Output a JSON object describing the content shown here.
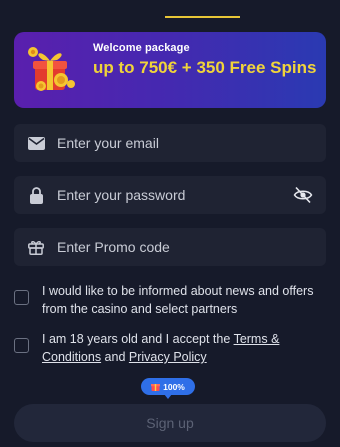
{
  "banner": {
    "small_text": "Welcome package",
    "headline": "up to 750€ + 350 Free Spins"
  },
  "form": {
    "email_placeholder": "Enter your email",
    "password_placeholder": "Enter your password",
    "promo_placeholder": "Enter Promo code"
  },
  "consents": {
    "news_text": "I would like to be informed about news and offers from the casino and select partners",
    "age_prefix": "I am 18 years old and I accept the ",
    "terms_link": "Terms & Conditions",
    "and_text": " and ",
    "privacy_link": "Privacy Policy"
  },
  "badge": {
    "text": "100%"
  },
  "signup": {
    "label": "Sign up"
  },
  "colors": {
    "background": "#161a2a",
    "accent_yellow": "#f0d43a",
    "badge_blue": "#2f6fe8"
  }
}
